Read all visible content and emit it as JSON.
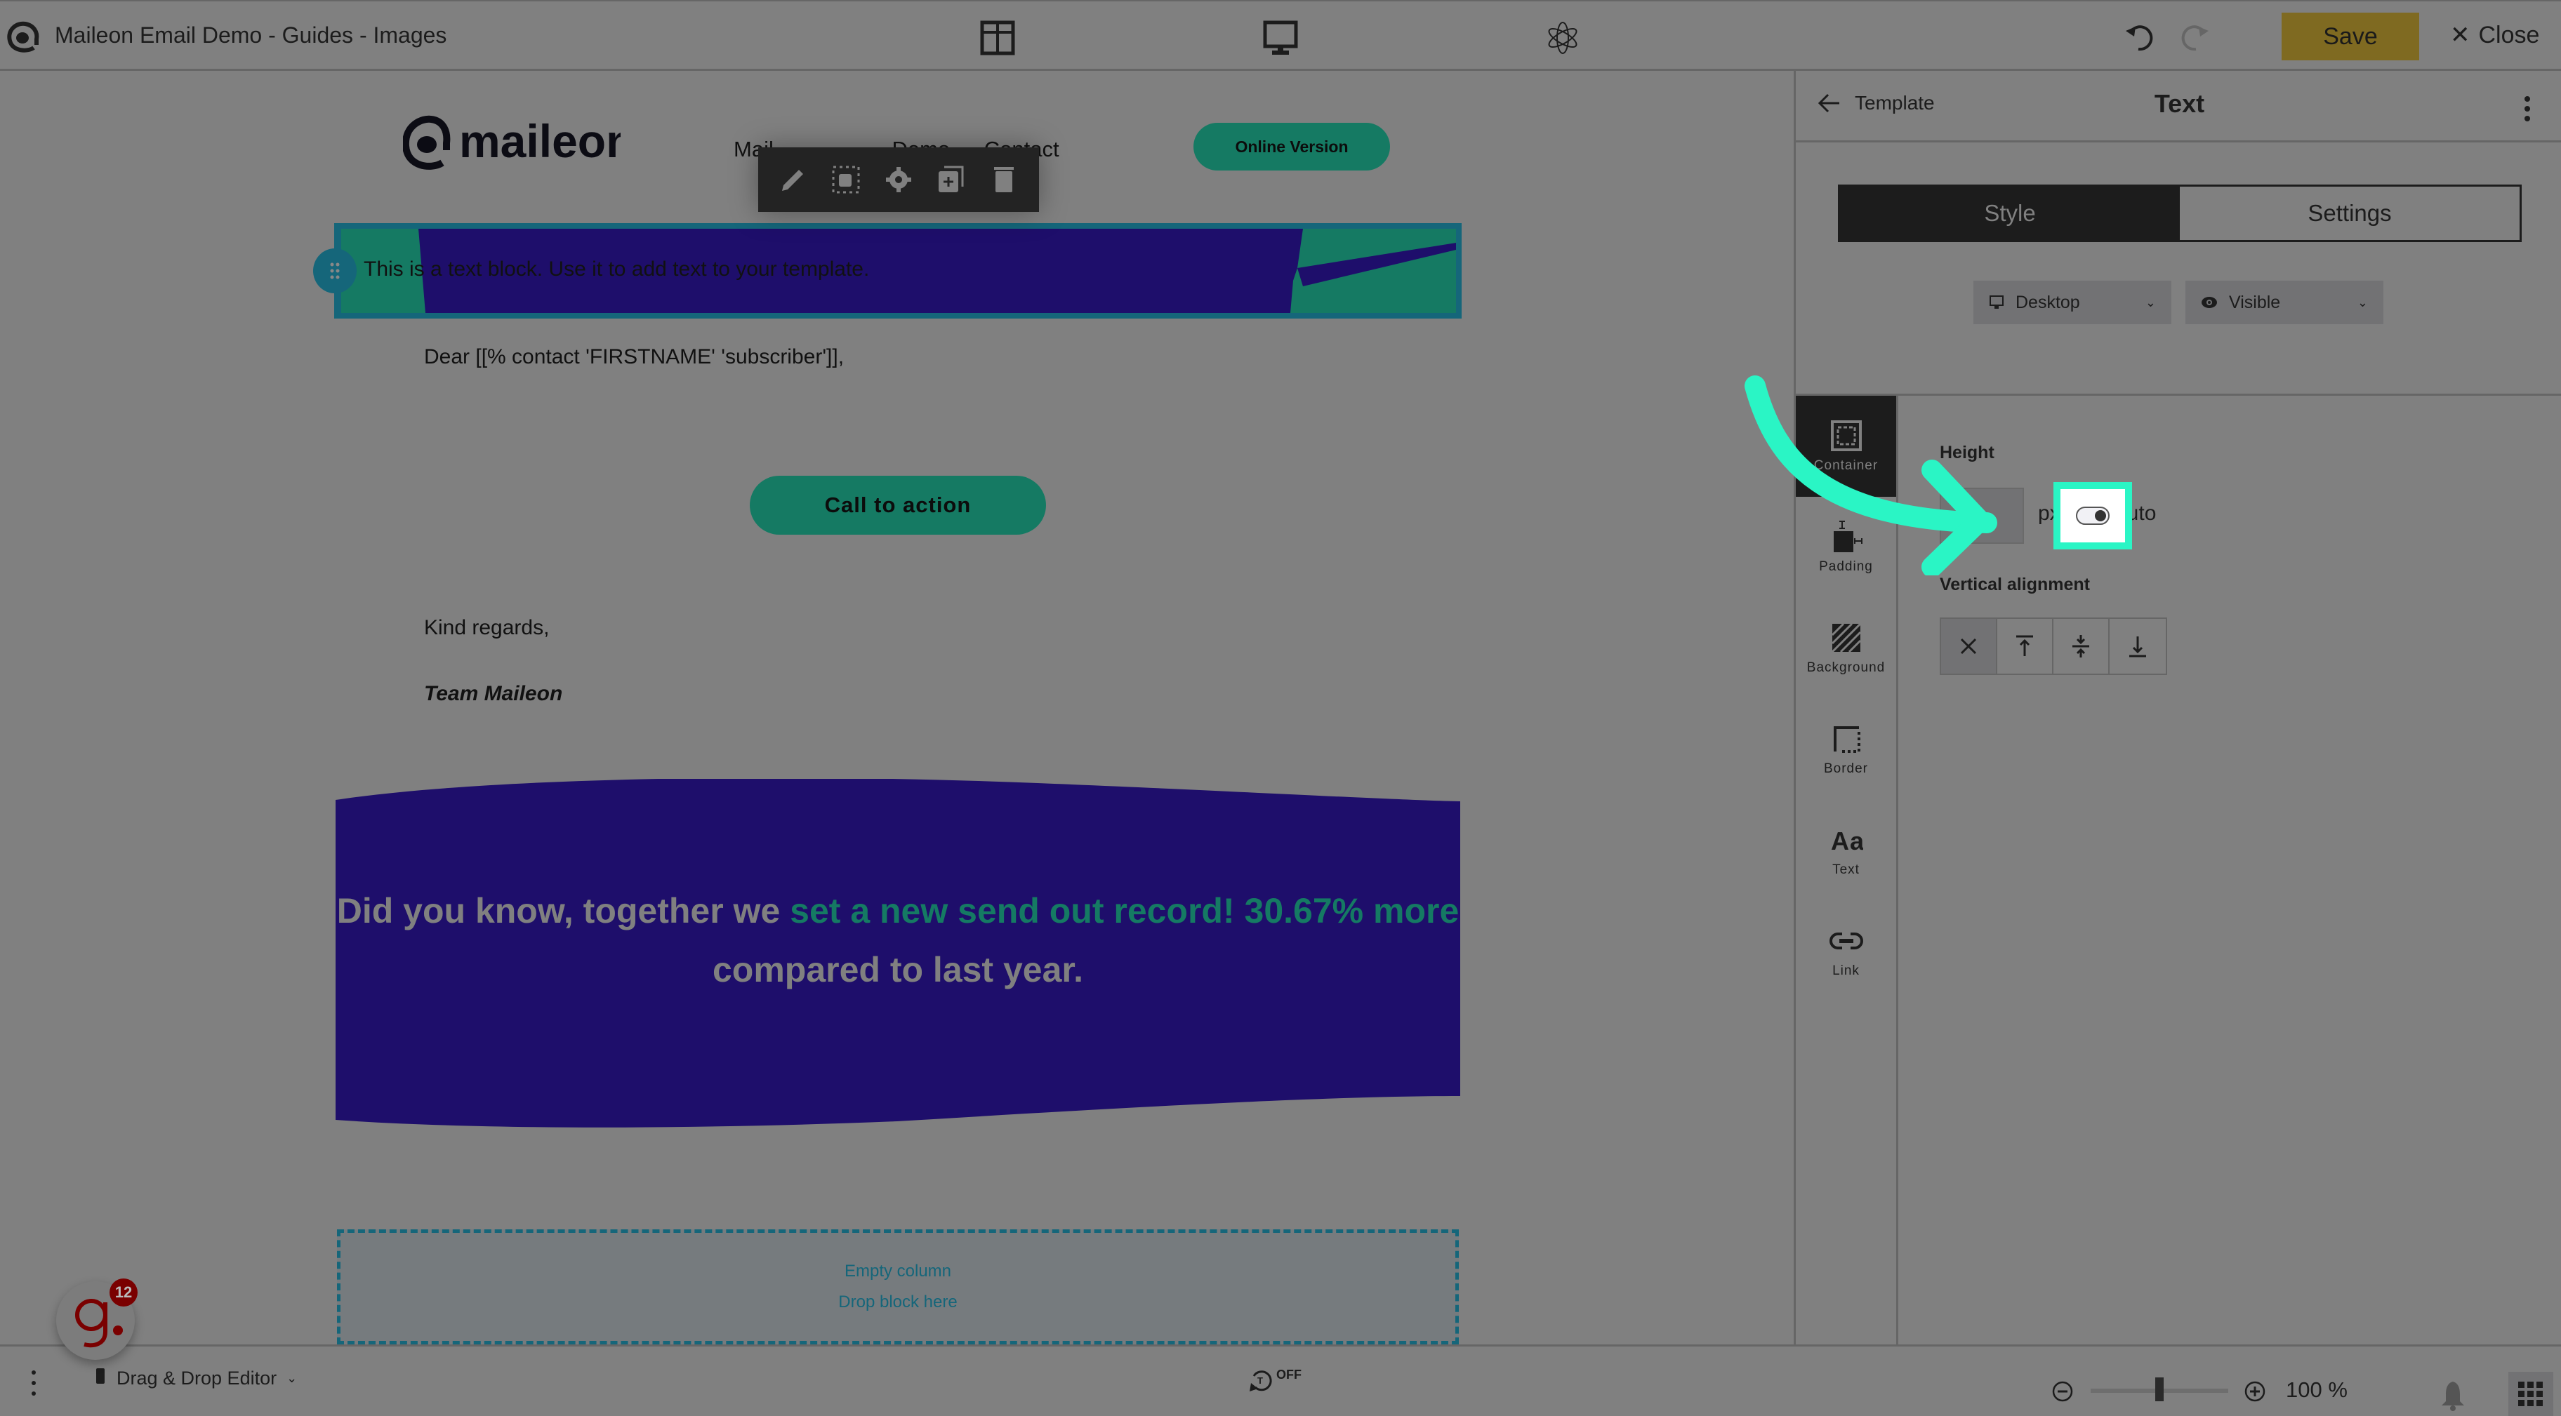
{
  "app": {
    "title": "Maileon Email Demo - Guides - Images",
    "save_label": "Save",
    "close_label": "Close",
    "accent_color": "#7f6a21",
    "highlight_color": "#2af5c5"
  },
  "top_icons": [
    "layout-grid-icon",
    "desktop-preview-icon",
    "atom-icon",
    "undo-icon",
    "redo-icon"
  ],
  "email": {
    "logo_text": "maileon",
    "nav": [
      "Mail",
      "Demo",
      "Contact"
    ],
    "online_version_label": "Online Version",
    "selected_block_text": "This is a text block. Use it to add text to your template.",
    "greeting": "Dear [[% contact 'FIRSTNAME' 'subscriber']],",
    "cta_label": "Call to action",
    "closing": "Kind regards,",
    "signature": "Team Maileon",
    "stat": {
      "part1": "Did you know, together we ",
      "part2": "set a new send out record! 30.67% more",
      "part3": " compared to last year."
    },
    "empty_column": {
      "line1": "Empty column",
      "line2": "Drop block here"
    },
    "brand_green": "#157a63",
    "brand_navy": "#1e0e6b"
  },
  "block_toolbar": [
    "edit-icon",
    "select-parent-icon",
    "settings-icon",
    "duplicate-icon",
    "delete-icon"
  ],
  "panel": {
    "back_label": "Template",
    "title": "Text",
    "tabs": [
      {
        "label": "Style",
        "active": true
      },
      {
        "label": "Settings",
        "active": false
      }
    ],
    "device_select": "Desktop",
    "visibility_select": "Visible",
    "side_tabs": [
      {
        "label": "Container",
        "active": true
      },
      {
        "label": "Padding",
        "active": false
      },
      {
        "label": "Background",
        "active": false
      },
      {
        "label": "Border",
        "active": false
      },
      {
        "label": "Text",
        "active": false
      },
      {
        "label": "Link",
        "active": false
      }
    ],
    "height": {
      "label": "Height",
      "value": "",
      "unit_px": "px",
      "unit_auto": "auto",
      "auto_enabled": true
    },
    "vertical_alignment": {
      "label": "Vertical alignment",
      "options": [
        "none",
        "top",
        "middle",
        "bottom"
      ],
      "selected": "none"
    }
  },
  "bottom_bar": {
    "editor_mode": "Drag & Drop Editor",
    "autosave_state": "OFF",
    "zoom_percent": 100,
    "zoom_label": "100 %",
    "zoom_slider_fraction": 0.5
  },
  "help_widget": {
    "letter": "g.",
    "badge_count": "12"
  }
}
